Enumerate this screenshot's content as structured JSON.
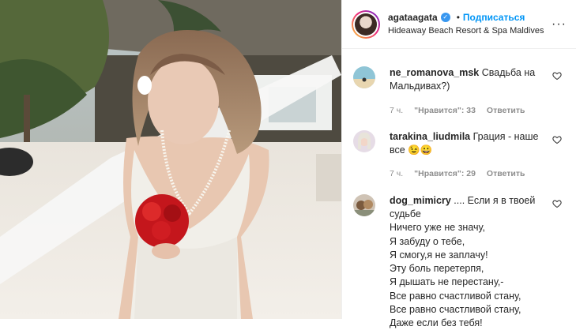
{
  "post": {
    "username": "agataagata",
    "follow_label": "Подписаться",
    "location": "Hideaway Beach Resort & Spa Maldives",
    "more_label": "···"
  },
  "comments": [
    {
      "user": "ne_romanova_msk",
      "text": "Свадьба на Мальдивах?)",
      "time": "7 ч.",
      "likes": "\"Нравится\": 33",
      "reply": "Ответить"
    },
    {
      "user": "tarakina_liudmila",
      "text": "Грация - наше все",
      "emoji": "😉😀",
      "time": "7 ч.",
      "likes": "\"Нравится\": 29",
      "reply": "Ответить"
    },
    {
      "user": "dog_mimicry",
      "text_first": ".... Если я в твоей судьбе",
      "lines": [
        "Ничего уже не значу,",
        "Я забуду о тебе,",
        "Я смогу,я не заплачу!",
        "Эту боль перетерпя,",
        "Я дышать не перестану,-",
        "Все равно счастливой стану,",
        "Все равно счастливой стану,",
        "Даже если без тебя!"
      ]
    }
  ],
  "colors": {
    "accent": "#0095f6",
    "muted": "#8e8e8e",
    "verified": "#3897f0"
  }
}
